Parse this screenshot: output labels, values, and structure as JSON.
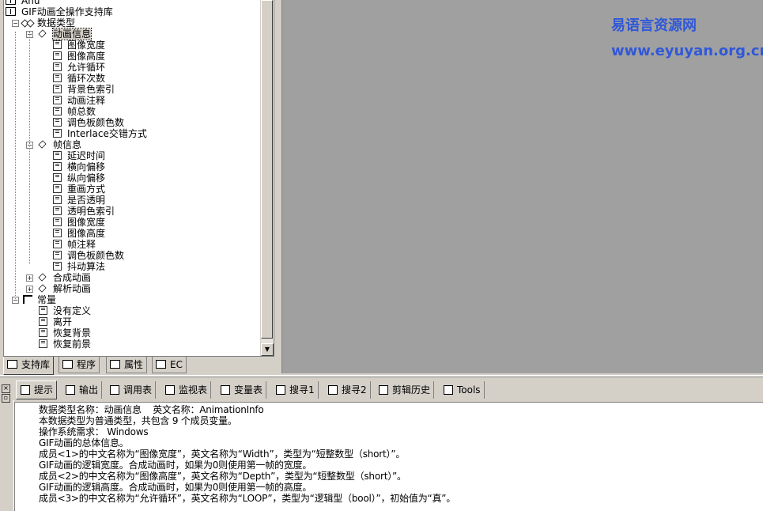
{
  "tree": {
    "top_partial": "Ahu",
    "root": "GIF动画全操作支持库",
    "types_label": "数据类型",
    "anim_info": {
      "label": "动画信息",
      "members": [
        "图像宽度",
        "图像高度",
        "允许循环",
        "循环次数",
        "背景色索引",
        "动画注释",
        "帧总数",
        "调色板颜色数",
        "Interlace交错方式"
      ]
    },
    "frame_info": {
      "label": "帧信息",
      "members": [
        "延迟时间",
        "横向偏移",
        "纵向偏移",
        "重画方式",
        "是否透明",
        "透明色索引",
        "图像宽度",
        "图像高度",
        "帧注释",
        "调色板颜色数",
        "抖动算法"
      ]
    },
    "compose_anim": "合成动画",
    "parse_anim": "解析动画",
    "constants": {
      "label": "常量",
      "members": [
        "没有定义",
        "离开",
        "恢复背景",
        "恢复前景"
      ]
    }
  },
  "tree_tabs": [
    "支持库",
    "程序",
    "属性",
    "EC"
  ],
  "brand": {
    "name": "易语言资源网",
    "url": "www.eyuyan.org.cn",
    "color": "#3058d8"
  },
  "output_tabs": [
    "提示",
    "输出",
    "调用表",
    "监视表",
    "变量表",
    "搜寻1",
    "搜寻2",
    "剪辑历史",
    "Tools"
  ],
  "output_lines": [
    "数据类型名称：动画信息    英文名称：AnimationInfo",
    "本数据类型为普通类型，共包含 9 个成员变量。",
    "操作系统需求： Windows",
    "GIF动画的总体信息。",
    "成员<1>的中文名称为“图像宽度”，英文名称为“Width”，类型为“短整数型（short）”。",
    "GIF动画的逻辑宽度。合成动画时，如果为0则使用第一帧的宽度。",
    "成员<2>的中文名称为“图像高度”，英文名称为“Depth”，类型为“短整数型（short）”。",
    "GIF动画的逻辑高度。合成动画时，如果为0则使用第一帧的高度。",
    "成员<3>的中文名称为“允许循环”，英文名称为“LOOP”，类型为“逻辑型（bool）”，初始值为“真”。"
  ]
}
